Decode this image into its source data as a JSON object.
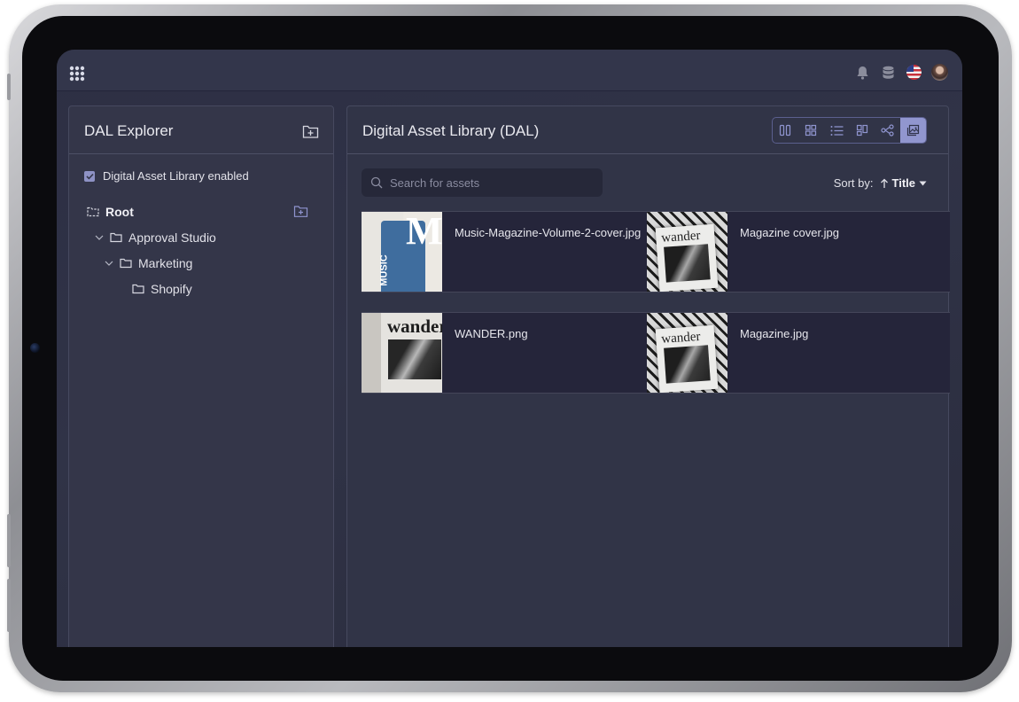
{
  "topbar": {
    "icons": [
      "logo-icon",
      "bell-icon",
      "database-icon",
      "us-flag-icon",
      "avatar"
    ]
  },
  "explorer": {
    "title": "DAL Explorer",
    "enabled_label": "Digital Asset Library enabled",
    "enabled": true,
    "tree": {
      "root": "Root",
      "approval_studio": "Approval Studio",
      "marketing": "Marketing",
      "shopify": "Shopify"
    }
  },
  "library": {
    "title": "Digital Asset Library (DAL)",
    "views": [
      "columns-view",
      "grid-view",
      "list-view",
      "board-view",
      "graph-view",
      "gallery-view"
    ],
    "active_view": "gallery-view",
    "search": {
      "placeholder": "Search for assets",
      "value": ""
    },
    "sort": {
      "label": "Sort by:",
      "value": "Title",
      "direction": "ascending"
    },
    "assets": [
      {
        "name": "Music-Magazine-Volume-2-cover.jpg"
      },
      {
        "name": "Magazine cover.jpg"
      },
      {
        "name": "WANDER.png"
      },
      {
        "name": "Magazine.jpg"
      }
    ]
  },
  "colors": {
    "accent": "#9196cf",
    "panel": "#343649",
    "background": "#2d2f44"
  }
}
